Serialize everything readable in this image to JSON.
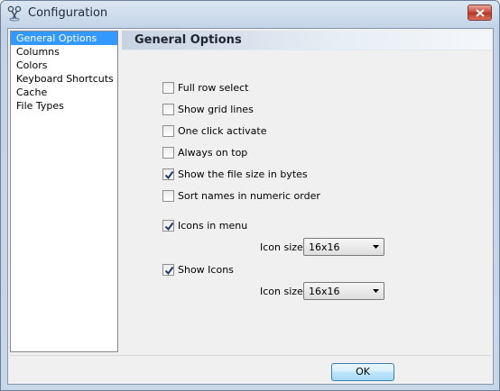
{
  "window": {
    "title": "Configuration"
  },
  "nav": {
    "items": [
      {
        "label": "General Options",
        "selected": true
      },
      {
        "label": "Columns",
        "selected": false
      },
      {
        "label": "Colors",
        "selected": false
      },
      {
        "label": "Keyboard Shortcuts",
        "selected": false
      },
      {
        "label": "Cache",
        "selected": false
      },
      {
        "label": "File Types",
        "selected": false
      }
    ]
  },
  "panel": {
    "title": "General Options",
    "options": {
      "full_row_select": {
        "label": "Full row select",
        "checked": false
      },
      "show_grid_lines": {
        "label": "Show grid lines",
        "checked": false
      },
      "one_click_activate": {
        "label": "One click activate",
        "checked": false
      },
      "always_on_top": {
        "label": "Always on top",
        "checked": false
      },
      "show_file_size_bytes": {
        "label": "Show the file size in bytes",
        "checked": true
      },
      "sort_numeric": {
        "label": "Sort names in numeric order",
        "checked": false
      },
      "icons_in_menu": {
        "label": "Icons in menu",
        "checked": true
      },
      "show_icons": {
        "label": "Show Icons",
        "checked": true
      }
    },
    "menu_icon_size": {
      "label": "Icon size",
      "value": "16x16"
    },
    "icon_size": {
      "label": "Icon size",
      "value": "16x16"
    }
  },
  "buttons": {
    "ok": "OK"
  },
  "colors": {
    "selection": "#3399ff",
    "check": "#1f3a68"
  }
}
